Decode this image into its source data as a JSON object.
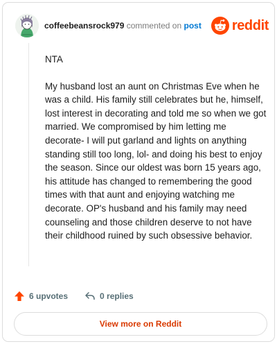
{
  "header": {
    "username": "coffeebeansrock979",
    "commented_text": "commented on",
    "post_link": "post",
    "brand": "reddit"
  },
  "comment": {
    "paragraphs": [
      "NTA",
      "My husband lost an aunt on Christmas Eve when he was a child. His family still celebrates but he, himself, lost interest in decorating and told me so when we got married. We compromised by him letting me decorate- I will put garland and lights on anything standing still too long, lol- and doing his best to enjoy the season. Since our oldest was born 15 years ago, his attitude has changed to remembering the good times with that aunt and enjoying watching me decorate. OP's husband and his family may need counseling and those children deserve to not have their childhood ruined by such obsessive behavior."
    ]
  },
  "actions": {
    "upvotes": "6 upvotes",
    "replies": "0 replies"
  },
  "footer": {
    "view_more": "View more on Reddit"
  },
  "colors": {
    "brand_orange": "#ff4500",
    "link_blue": "#0079d3",
    "upvote_orange": "#ff4500",
    "muted_gray": "#576f76",
    "view_more_text": "#d93a00"
  },
  "icons": [
    "avatar-icon",
    "reddit-snoo-icon",
    "upvote-arrow-icon",
    "reply-arrow-icon"
  ]
}
